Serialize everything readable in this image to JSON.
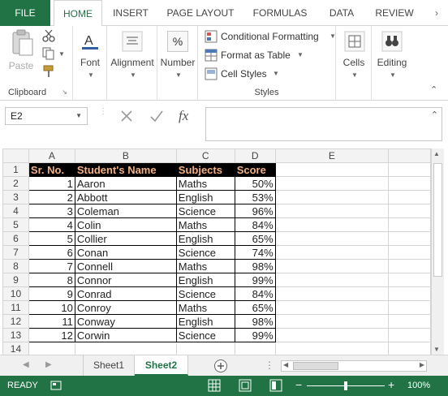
{
  "tabs": [
    "FILE",
    "HOME",
    "INSERT",
    "PAGE LAYOUT",
    "FORMULAS",
    "DATA",
    "REVIEW"
  ],
  "ribbon": {
    "clipboard": {
      "paste": "Paste",
      "label": "Clipboard"
    },
    "font": {
      "label": "Font"
    },
    "alignment": {
      "label": "Alignment"
    },
    "number": {
      "label": "Number",
      "icon_text": "%"
    },
    "styles": {
      "conditional": "Conditional Formatting",
      "format_table": "Format as Table",
      "cell_styles": "Cell Styles",
      "label": "Styles"
    },
    "cells": {
      "label": "Cells"
    },
    "editing": {
      "label": "Editing"
    }
  },
  "formula_bar": {
    "name_box": "E2",
    "fx": "fx",
    "formula": ""
  },
  "columns": [
    "A",
    "B",
    "C",
    "D",
    "E"
  ],
  "table": {
    "headers": [
      "Sr. No.",
      "Student's Name",
      "Subjects",
      "Score"
    ],
    "rows": [
      [
        "1",
        "Aaron",
        "Maths",
        "50%"
      ],
      [
        "2",
        "Abbott",
        "English",
        "53%"
      ],
      [
        "3",
        "Coleman",
        "Science",
        "96%"
      ],
      [
        "4",
        "Colin",
        "Maths",
        "84%"
      ],
      [
        "5",
        "Collier",
        "English",
        "65%"
      ],
      [
        "6",
        "Conan",
        "Science",
        "74%"
      ],
      [
        "7",
        "Connell",
        "Maths",
        "98%"
      ],
      [
        "8",
        "Connor",
        "English",
        "99%"
      ],
      [
        "9",
        "Conrad",
        "Science",
        "84%"
      ],
      [
        "10",
        "Conroy",
        "Maths",
        "65%"
      ],
      [
        "11",
        "Conway",
        "English",
        "98%"
      ],
      [
        "12",
        "Corwin",
        "Science",
        "99%"
      ]
    ]
  },
  "row_numbers": [
    "1",
    "2",
    "3",
    "4",
    "5",
    "6",
    "7",
    "8",
    "9",
    "10",
    "11",
    "12",
    "13",
    "14"
  ],
  "sheets": [
    "Sheet1",
    "Sheet2"
  ],
  "active_sheet": "Sheet2",
  "status": {
    "ready": "READY",
    "zoom": "100%",
    "zoom_minus": "−",
    "zoom_plus": "+"
  },
  "colors": {
    "excel_green": "#217346",
    "header_text": "#f4b183",
    "header_bg": "#000000"
  }
}
